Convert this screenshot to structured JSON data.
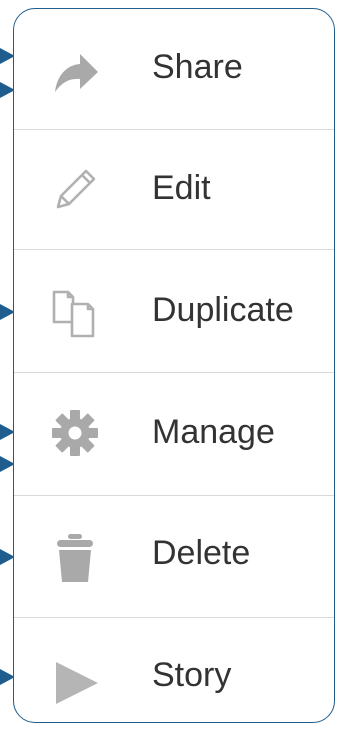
{
  "menu": {
    "items": [
      {
        "label": "Share",
        "icon": "share-icon"
      },
      {
        "label": "Edit",
        "icon": "pencil-icon"
      },
      {
        "label": "Duplicate",
        "icon": "duplicate-icon"
      },
      {
        "label": "Manage",
        "icon": "gear-icon"
      },
      {
        "label": "Delete",
        "icon": "trash-icon"
      },
      {
        "label": "Story",
        "icon": "play-icon"
      }
    ]
  },
  "colors": {
    "border": "#1f5d8e",
    "arrow": "#1f5d8e",
    "icon": "#aaaaaa",
    "label": "#333333",
    "divider": "#d9d9d9"
  }
}
